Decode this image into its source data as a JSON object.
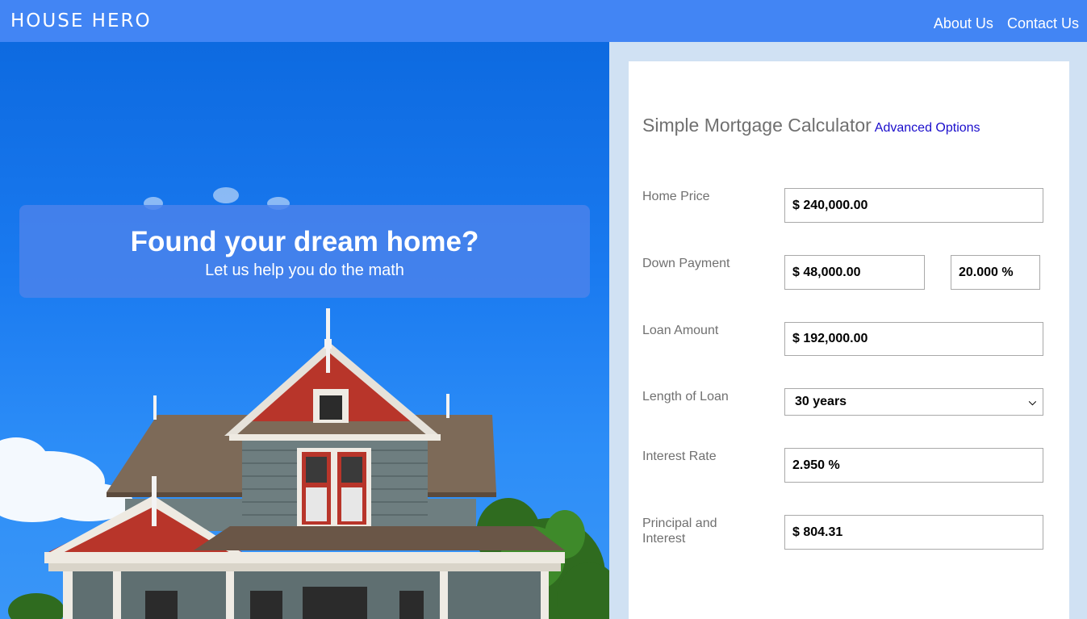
{
  "header": {
    "brand": "HOUSE HERO",
    "nav": [
      "About Us",
      "Contact Us"
    ]
  },
  "hero": {
    "title": "Found your dream home?",
    "subtitle": "Let us help you do the math"
  },
  "calculator": {
    "title": "Simple Mortgage Calculator",
    "advanced_link": "Advanced Options",
    "home_price": {
      "label": "Home Price",
      "value": "$ 240,000.00"
    },
    "down_payment": {
      "label": "Down Payment",
      "value": "$ 48,000.00",
      "percent": "20.000 %"
    },
    "loan_amount": {
      "label": "Loan Amount",
      "value": "$ 192,000.00"
    },
    "loan_length": {
      "label": "Length of Loan",
      "selected": "30 years"
    },
    "interest_rate": {
      "label": "Interest Rate",
      "value": "2.950 %"
    },
    "principal_interest": {
      "label": "Principal and Interest",
      "value": "$ 804.31"
    }
  },
  "colors": {
    "header_bg": "#4285f4",
    "page_bg": "#d0e1f3",
    "link": "#1a0dcc"
  }
}
